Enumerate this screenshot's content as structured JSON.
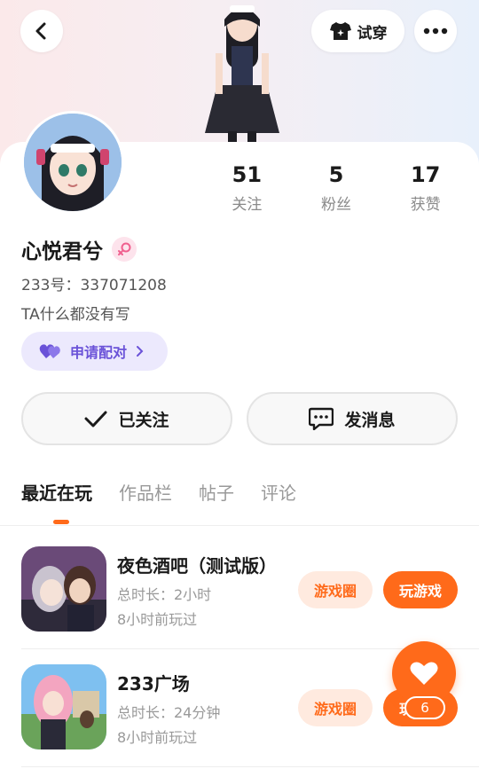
{
  "header": {
    "back_icon": "chevron-left-icon",
    "tryon_label": "试穿",
    "tryon_icon": "tshirt-sparkle-icon",
    "more_icon": "more-dots-icon"
  },
  "profile": {
    "username": "心悦君兮",
    "gender_icon": "female-icon",
    "uid": "233号：337071208",
    "bio": "TA什么都没有写",
    "stats": [
      {
        "value": "51",
        "label": "关注"
      },
      {
        "value": "5",
        "label": "粉丝"
      },
      {
        "value": "17",
        "label": "获赞"
      }
    ],
    "pair_label": "申请配对"
  },
  "actions": {
    "follow_label": "已关注",
    "message_label": "发消息"
  },
  "tabs": [
    {
      "label": "最近在玩",
      "active": true
    },
    {
      "label": "作品栏",
      "active": false
    },
    {
      "label": "帖子",
      "active": false
    },
    {
      "label": "评论",
      "active": false
    }
  ],
  "games": [
    {
      "title": "夜色酒吧（测试版）",
      "duration": "总时长：2小时",
      "last_played": "8小时前玩过",
      "circle_label": "游戏圈",
      "play_label": "玩游戏"
    },
    {
      "title": "233广场",
      "duration": "总时长：24分钟",
      "last_played": "8小时前玩过",
      "circle_label": "游戏圈",
      "play_label": "玩游戏"
    }
  ],
  "floating_like": {
    "icon": "heart-icon",
    "count": "6"
  },
  "colors": {
    "accent": "#ff6a1a",
    "pair_text": "#6a52d8",
    "pair_bg": "#ece9fd"
  }
}
